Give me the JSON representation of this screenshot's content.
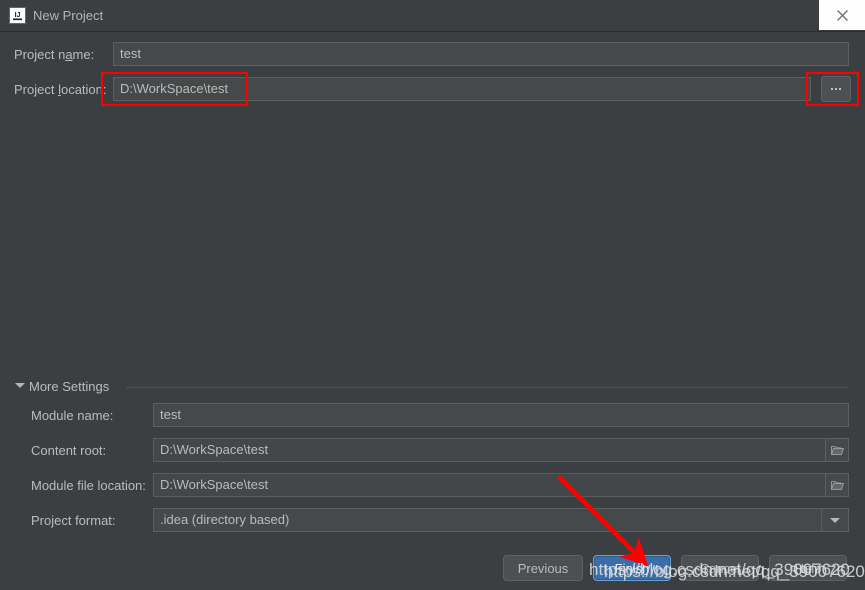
{
  "window": {
    "title": "New Project",
    "app_icon": "intellij-idea-icon",
    "close_label": "close-icon"
  },
  "form": {
    "project_name": {
      "label": "Project name:",
      "label_mnemonic": "a",
      "value": "test",
      "placeholder": ""
    },
    "project_location": {
      "label": "Project location:",
      "label_mnemonic": "l",
      "value": "D:\\WorkSpace\\test",
      "placeholder": "",
      "browse_label": "..."
    }
  },
  "more_settings": {
    "label": "More Settings",
    "expanded": true,
    "fields": [
      {
        "name": "module-name",
        "label": "Module name:",
        "value": "test",
        "has_folder_button": false,
        "has_dropdown": false
      },
      {
        "name": "content-root",
        "label": "Content root:",
        "value": "D:\\WorkSpace\\test",
        "has_folder_button": true,
        "has_dropdown": false
      },
      {
        "name": "module-file-location",
        "label": "Module file location:",
        "value": "D:\\WorkSpace\\test",
        "has_folder_button": true,
        "has_dropdown": false
      },
      {
        "name": "project-format",
        "label": "Project format:",
        "value": ".idea (directory based)",
        "has_folder_button": false,
        "has_dropdown": true
      }
    ]
  },
  "buttons": {
    "previous": "Previous",
    "finish": "Finish",
    "cancel": "Cancel",
    "help": "Help"
  },
  "annotations": {
    "highlight_location_field": true,
    "highlight_browse_button": true,
    "arrow_to_finish": true,
    "accent_color": "#fe0000",
    "watermark_primary": "https://blog.csdn.net/qq_39007620",
    "watermark_secondary": "https://blog.csdn.net/qq_39007620"
  },
  "colors": {
    "dialog_bg": "#3c3f41",
    "field_bg": "#45494a",
    "text": "#bbbbbb",
    "primary_button": "#3b6ea8",
    "annotation": "#fe0000"
  }
}
